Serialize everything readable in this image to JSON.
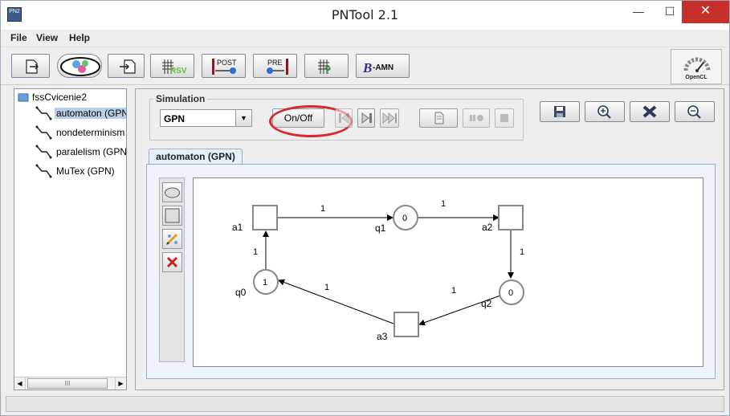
{
  "window": {
    "title": "PNTool 2.1",
    "app_icon_text": "PN2",
    "minimize": "—",
    "maximize": "☐",
    "close": "✕"
  },
  "menu": {
    "items": [
      "File",
      "View",
      "Help"
    ]
  },
  "toolbar": {
    "buttons": [
      {
        "name": "open-file",
        "icon": "open-file-icon"
      },
      {
        "name": "gpn",
        "icon": "gpn-logo-icon"
      },
      {
        "name": "import",
        "icon": "import-icon"
      },
      {
        "name": "rsv",
        "label": "RSV",
        "icon": "grid-rsv-icon"
      },
      {
        "name": "post",
        "label": "POST",
        "icon": "post-matrix-icon"
      },
      {
        "name": "pre",
        "label": "PRE",
        "icon": "pre-matrix-icon"
      },
      {
        "name": "help-grid",
        "icon": "grid-help-icon"
      },
      {
        "name": "bamn",
        "label": "-AMN",
        "prefix": "B",
        "icon": "bamn-icon"
      }
    ],
    "opencl_label": "OpenCL"
  },
  "tree": {
    "root": "fssCvicenie2",
    "items": [
      {
        "label": "automaton (GPN)",
        "selected": true
      },
      {
        "label": "nondeterminism",
        "selected": false
      },
      {
        "label": "paralelism (GPN)",
        "selected": false
      },
      {
        "label": "MuTex (GPN)",
        "selected": false
      }
    ],
    "scroll_thumb": "III"
  },
  "simulation": {
    "title": "Simulation",
    "selected_type": "GPN",
    "onoff_label": "On/Off"
  },
  "tab": {
    "label": "automaton (GPN)"
  },
  "net": {
    "transitions": [
      "a1",
      "a2",
      "a3"
    ],
    "places": [
      {
        "name": "q0",
        "tokens": "1"
      },
      {
        "name": "q1",
        "tokens": "0"
      },
      {
        "name": "q2",
        "tokens": "0"
      }
    ],
    "arcs": [
      {
        "from": "a1",
        "to": "q1",
        "weight": "1"
      },
      {
        "from": "q1",
        "to": "a2",
        "weight": "1"
      },
      {
        "from": "a2",
        "to": "q2",
        "weight": "1"
      },
      {
        "from": "q2",
        "to": "a3",
        "weight": "1"
      },
      {
        "from": "a3",
        "to": "q0",
        "weight": "1"
      },
      {
        "from": "q0",
        "to": "a1",
        "weight": "1"
      }
    ]
  },
  "colors": {
    "accent": "#d8282e",
    "selection": "#b8cfe6",
    "close_button": "#c7302a"
  }
}
